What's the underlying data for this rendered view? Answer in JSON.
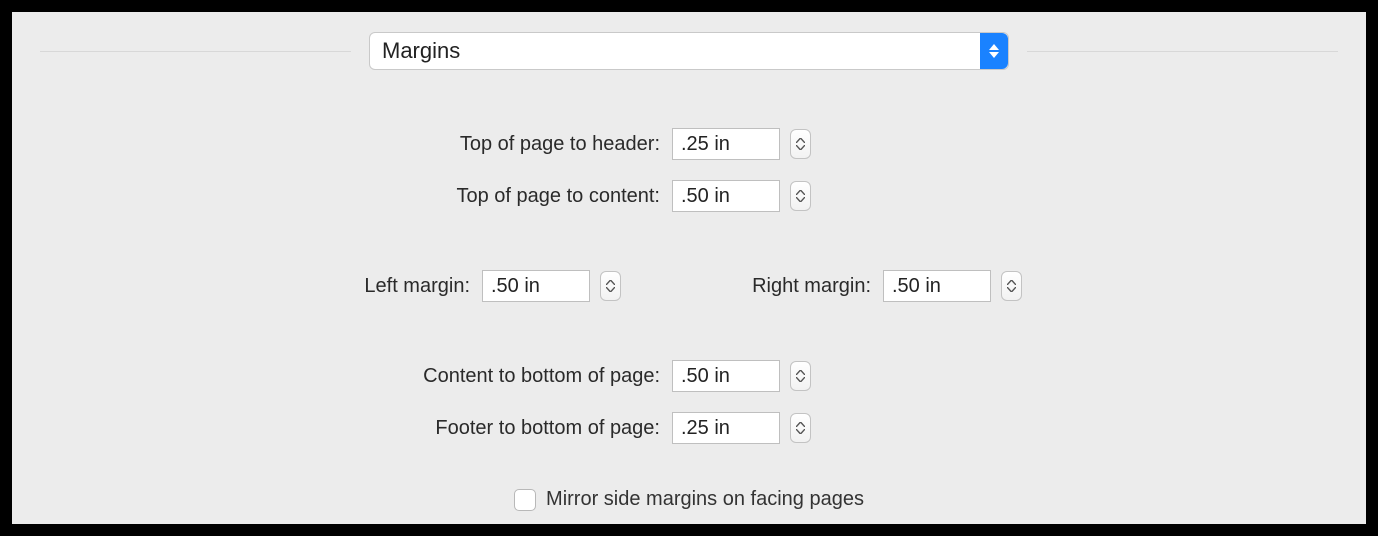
{
  "dropdown": {
    "selected": "Margins"
  },
  "fields": {
    "top_header": {
      "label": "Top of page to header:",
      "value": ".25 in"
    },
    "top_content": {
      "label": "Top of page to content:",
      "value": ".50 in"
    },
    "left_margin": {
      "label": "Left margin:",
      "value": ".50 in"
    },
    "right_margin": {
      "label": "Right margin:",
      "value": ".50 in"
    },
    "content_bottom": {
      "label": "Content to bottom of page:",
      "value": ".50 in"
    },
    "footer_bottom": {
      "label": "Footer to bottom of page:",
      "value": ".25 in"
    }
  },
  "mirror": {
    "label": "Mirror side margins on facing pages",
    "checked": false
  }
}
